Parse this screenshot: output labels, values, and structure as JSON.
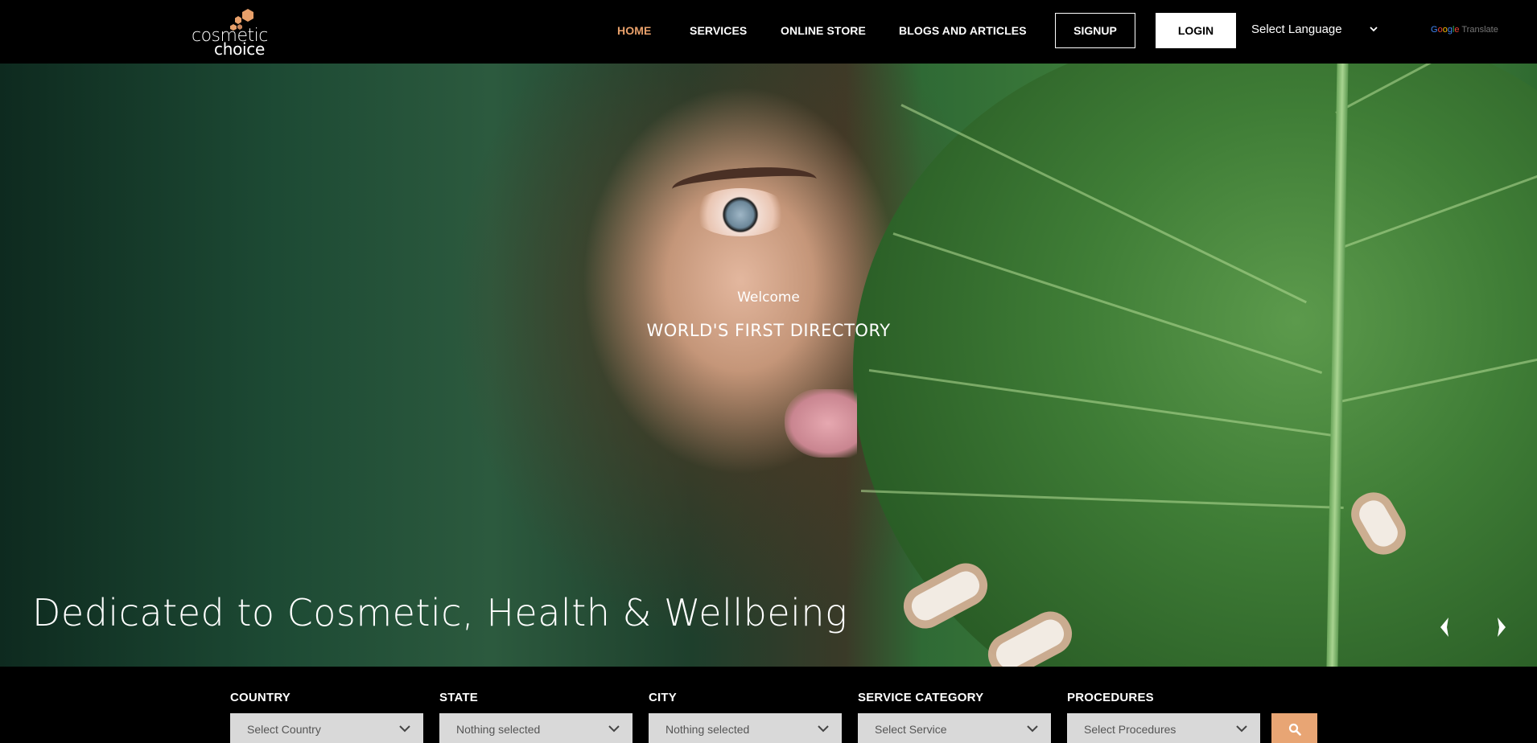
{
  "header": {
    "logo": {
      "line1": "cosmetic",
      "line2": "choice",
      "mark_color": "#e8a06a"
    },
    "nav": [
      {
        "label": "HOME",
        "active": true
      },
      {
        "label": "SERVICES",
        "active": false
      },
      {
        "label": "ONLINE STORE",
        "active": false
      },
      {
        "label": "BLOGS AND ARTICLES",
        "active": false
      }
    ],
    "signup_label": "SIGNUP",
    "login_label": "LOGIN",
    "language_select": {
      "value": "Select Language"
    },
    "google_translate": {
      "brand": "Google",
      "label": "Translate"
    }
  },
  "hero": {
    "welcome": "Welcome",
    "subtitle": "WORLD'S FIRST DIRECTORY",
    "title": "Dedicated to Cosmetic, Health & Wellbeing",
    "prev_icon": "chevron-left-icon",
    "next_icon": "chevron-right-icon"
  },
  "search": {
    "fields": [
      {
        "label": "COUNTRY",
        "value": "Select Country"
      },
      {
        "label": "STATE",
        "value": "Nothing selected"
      },
      {
        "label": "CITY",
        "value": "Nothing selected"
      },
      {
        "label": "SERVICE CATEGORY",
        "value": "Select Service"
      },
      {
        "label": "PROCEDURES",
        "value": "Select Procedures"
      }
    ],
    "button_icon": "search-icon",
    "accent": "#e8a574"
  },
  "colors": {
    "accent": "#e8a06a",
    "background": "#000000",
    "select_bg": "#d9d9d9"
  }
}
